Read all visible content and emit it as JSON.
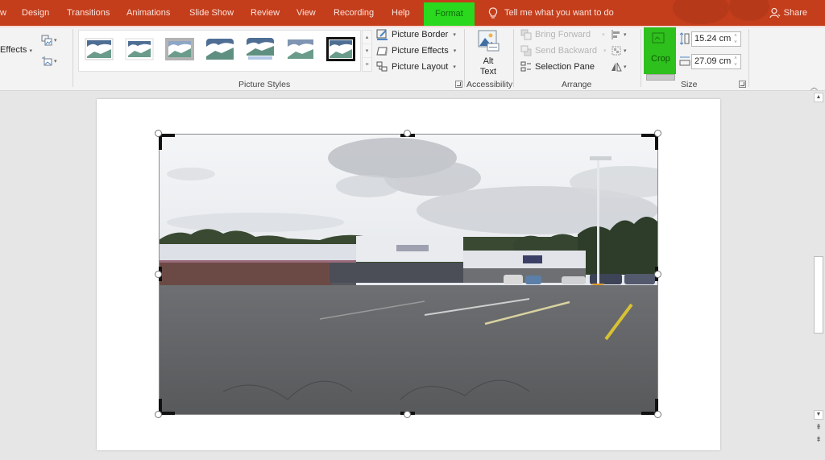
{
  "tabs": [
    {
      "id": "prev",
      "label": "w"
    },
    {
      "id": "design",
      "label": "Design"
    },
    {
      "id": "transitions",
      "label": "Transitions"
    },
    {
      "id": "animations",
      "label": "Animations"
    },
    {
      "id": "slideshow",
      "label": "Slide Show"
    },
    {
      "id": "review",
      "label": "Review"
    },
    {
      "id": "view",
      "label": "View"
    },
    {
      "id": "recording",
      "label": "Recording"
    },
    {
      "id": "help",
      "label": "Help"
    },
    {
      "id": "format",
      "label": "Format",
      "active": true
    }
  ],
  "tell_me": {
    "placeholder": "Tell me what you want to do"
  },
  "share": {
    "label": "Share"
  },
  "ribbon": {
    "effects_label": "Effects",
    "picture_styles": {
      "label": "Picture Styles",
      "selected_index": 6,
      "count": 7
    },
    "picture_border": "Picture Border",
    "picture_effects": "Picture Effects",
    "picture_layout": "Picture Layout",
    "accessibility": {
      "label": "Accessibility",
      "alt_text_line1": "Alt",
      "alt_text_line2": "Text"
    },
    "arrange": {
      "label": "Arrange",
      "bring_forward": "Bring Forward",
      "send_backward": "Send Backward",
      "selection_pane": "Selection Pane"
    },
    "size": {
      "label": "Size",
      "crop": "Crop",
      "height": "15.24 cm",
      "width": "27.09 cm"
    }
  },
  "colors": {
    "tab_bar": "#c43e1c",
    "highlight": "#2ad81d",
    "ribbon": "#f3f3f3",
    "workspace": "#e6e6e6"
  }
}
